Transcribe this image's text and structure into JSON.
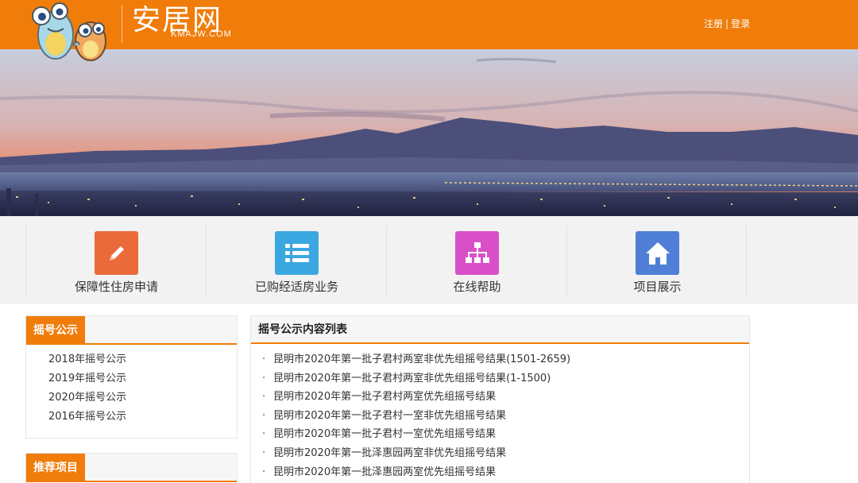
{
  "header": {
    "logo_cn": "安居网",
    "logo_en": "KMAJW.COM",
    "register_label": "注册",
    "separator": "|",
    "login_label": "登录",
    "brand_color": "#f07c0a"
  },
  "quicknav": {
    "items": [
      {
        "label": "保障性住房申请",
        "icon": "pencil-icon",
        "color": "#ea6a3a"
      },
      {
        "label": "已购经适房业务",
        "icon": "list-icon",
        "color": "#3ba7e1"
      },
      {
        "label": "在线帮助",
        "icon": "sitemap-icon",
        "color": "#d94fc8"
      },
      {
        "label": "项目展示",
        "icon": "home-icon",
        "color": "#4f7fd6"
      }
    ]
  },
  "sidebar": {
    "lottery_title": "摇号公示",
    "lottery_items": [
      "2018年摇号公示",
      "2019年摇号公示",
      "2020年摇号公示",
      "2016年摇号公示"
    ],
    "recommend_title": "推荐项目"
  },
  "main": {
    "title": "摇号公示内容列表",
    "bullet": "·",
    "items": [
      "昆明市2020年第一批子君村两室非优先组摇号结果(1501-2659)",
      "昆明市2020年第一批子君村两室非优先组摇号结果(1-1500)",
      "昆明市2020年第一批子君村两室优先组摇号结果",
      "昆明市2020年第一批子君村一室非优先组摇号结果",
      "昆明市2020年第一批子君村一室优先组摇号结果",
      "昆明市2020年第一批泽惠园两室非优先组摇号结果",
      "昆明市2020年第一批泽惠园两室优先组摇号结果"
    ]
  }
}
